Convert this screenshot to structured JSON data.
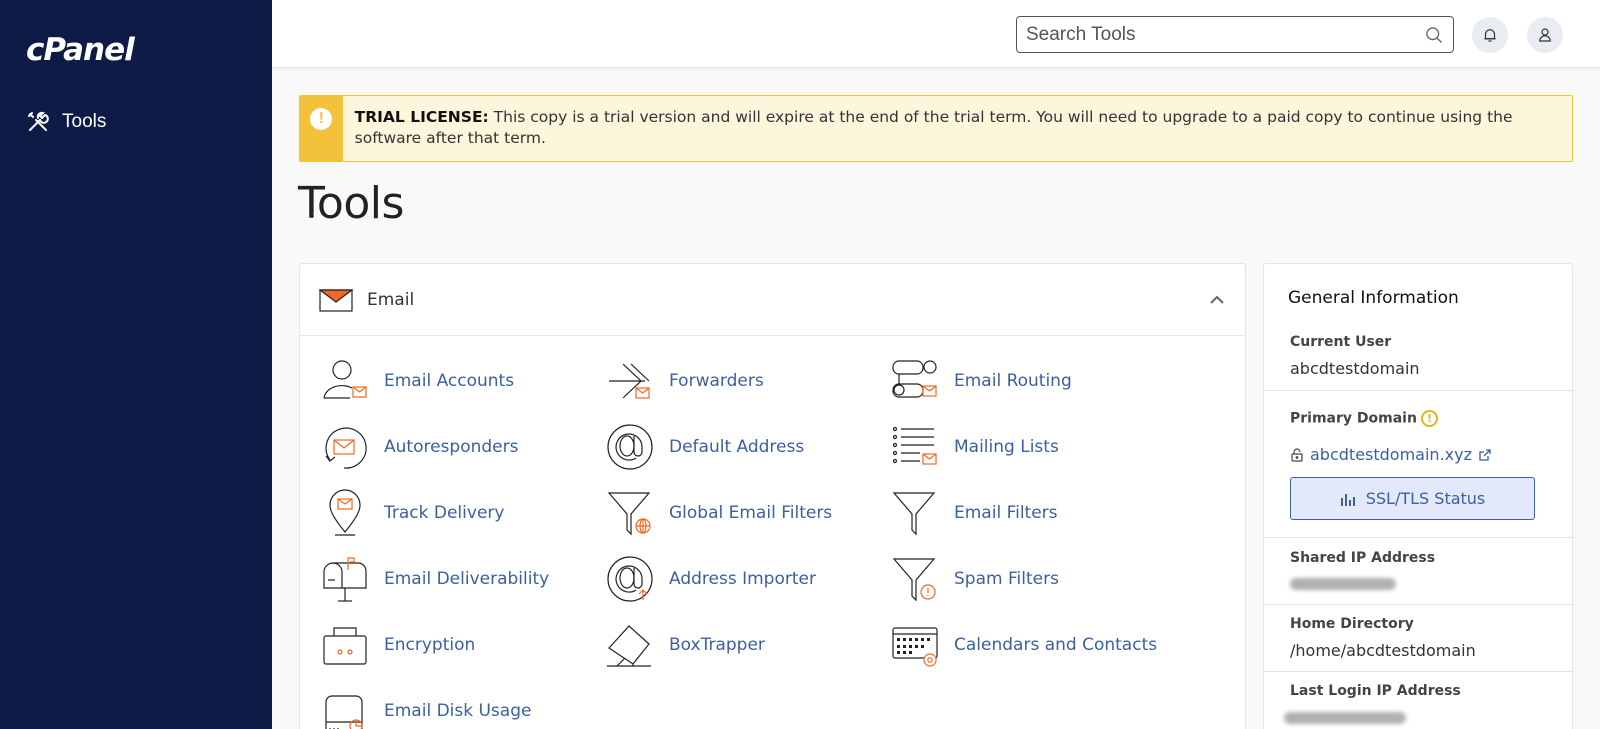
{
  "sidebar": {
    "logo": "cPanel",
    "nav": [
      {
        "label": "Tools",
        "icon": "tools-icon"
      }
    ]
  },
  "header": {
    "search_placeholder": "Search Tools",
    "icons": [
      "search-icon",
      "bell-icon",
      "user-icon"
    ]
  },
  "alert": {
    "title": "TRIAL LICENSE:",
    "message": "This copy is a trial version and will expire at the end of the trial term. You will need to upgrade to a paid copy to continue using the software after that term."
  },
  "page": {
    "title": "Tools"
  },
  "email_section": {
    "label": "Email",
    "tools": [
      {
        "label": "Email Accounts",
        "icon": "email-accounts-icon"
      },
      {
        "label": "Forwarders",
        "icon": "forwarders-icon"
      },
      {
        "label": "Email Routing",
        "icon": "email-routing-icon"
      },
      {
        "label": "Autoresponders",
        "icon": "autoresponders-icon"
      },
      {
        "label": "Default Address",
        "icon": "default-address-icon"
      },
      {
        "label": "Mailing Lists",
        "icon": "mailing-lists-icon"
      },
      {
        "label": "Track Delivery",
        "icon": "track-delivery-icon"
      },
      {
        "label": "Global Email Filters",
        "icon": "global-email-filters-icon"
      },
      {
        "label": "Email Filters",
        "icon": "email-filters-icon"
      },
      {
        "label": "Email Deliverability",
        "icon": "email-deliverability-icon"
      },
      {
        "label": "Address Importer",
        "icon": "address-importer-icon"
      },
      {
        "label": "Spam Filters",
        "icon": "spam-filters-icon"
      },
      {
        "label": "Encryption",
        "icon": "encryption-icon"
      },
      {
        "label": "BoxTrapper",
        "icon": "boxtrapper-icon"
      },
      {
        "label": "Calendars and Contacts",
        "icon": "calendars-contacts-icon"
      },
      {
        "label": "Email Disk Usage",
        "icon": "email-disk-usage-icon"
      }
    ]
  },
  "general_info": {
    "title": "General Information",
    "current_user_label": "Current User",
    "current_user": "abcdtestdomain",
    "primary_domain_label": "Primary Domain",
    "primary_domain": "abcdtestdomain.xyz",
    "ssl_button": "SSL/TLS Status",
    "shared_ip_label": "Shared IP Address",
    "home_dir_label": "Home Directory",
    "home_dir": "/home/abcdtestdomain",
    "last_login_label": "Last Login IP Address"
  },
  "colors": {
    "sidebar_bg": "#0e1b47",
    "link": "#3c5fa0",
    "accent_orange": "#f26722",
    "alert_yellow": "#f3c23a"
  }
}
